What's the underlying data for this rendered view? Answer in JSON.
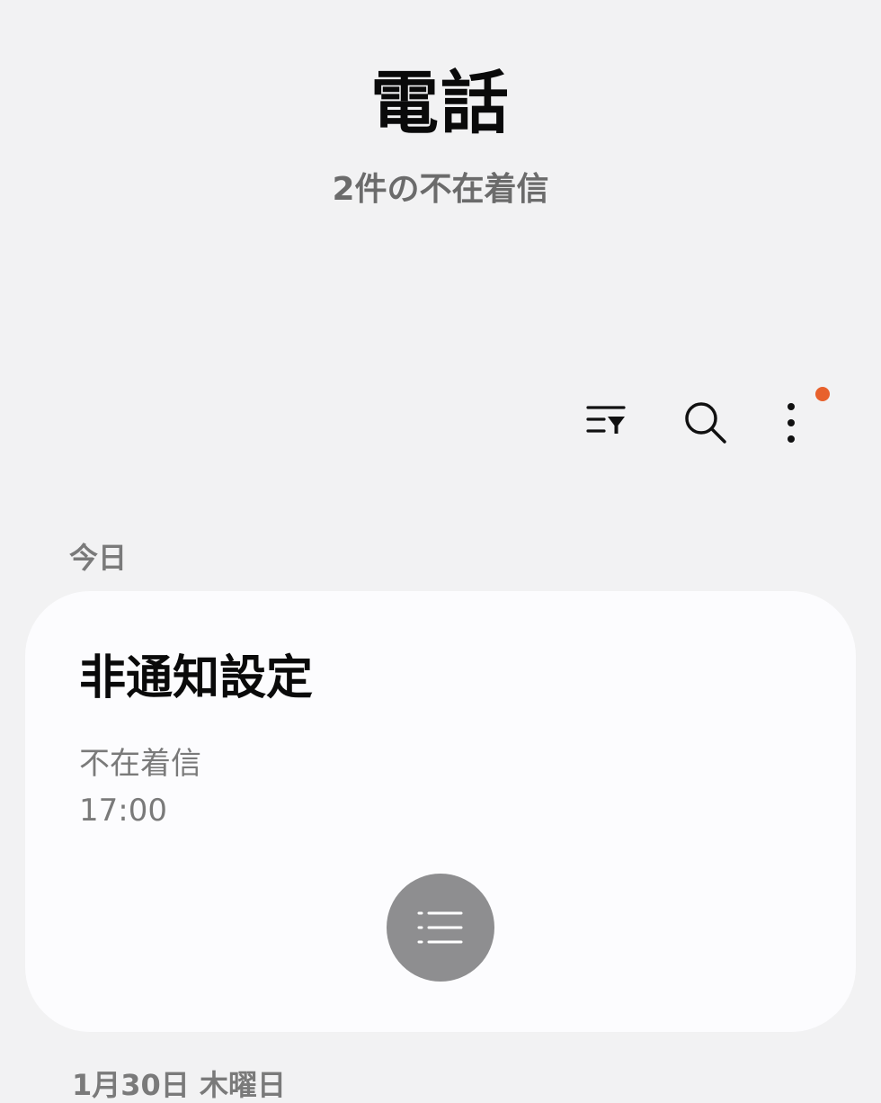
{
  "header": {
    "title": "電話",
    "subtitle": "2件の不在着信"
  },
  "toolbar": {
    "icons": [
      "filter-list-icon",
      "search-icon",
      "more-vert-icon"
    ],
    "badge_color": "#e8612c"
  },
  "sections": [
    {
      "label": "今日",
      "items": [
        {
          "name": "非通知設定",
          "status": "不在着信",
          "time": "17:00",
          "action_icon": "list-icon"
        }
      ]
    },
    {
      "label": "1月30日 木曜日"
    }
  ],
  "colors": {
    "background": "#f2f2f3",
    "card": "#fcfcfe",
    "secondary_text": "#7a7a7a",
    "action_button": "#8e8e90"
  }
}
